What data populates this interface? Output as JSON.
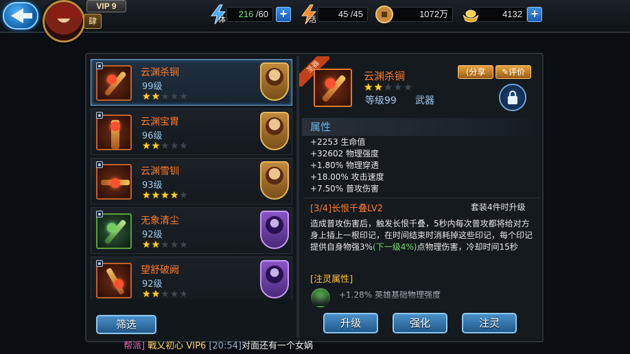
{
  "header": {
    "vip": "VIP 9",
    "rank": "肆",
    "stamina": {
      "label": "体",
      "value": "216",
      "max": "/60"
    },
    "energy": {
      "label": "活",
      "value": "45 /45"
    },
    "coins": "1072万",
    "gold": "4132",
    "plus": "+"
  },
  "equipment_list": [
    {
      "name": "云渊杀锏",
      "level": "99级",
      "stars": 2,
      "hero_color": "gold"
    },
    {
      "name": "云渊宝胄",
      "level": "96级",
      "stars": 2,
      "hero_color": "gold"
    },
    {
      "name": "云渊雪钏",
      "level": "93级",
      "stars": 4,
      "hero_color": "gold"
    },
    {
      "name": "无象清尘",
      "level": "92级",
      "stars": 2,
      "hero_color": "purple"
    },
    {
      "name": "望舒破阙",
      "level": "92级",
      "stars": 2,
      "hero_color": "purple"
    }
  ],
  "star_on": "★",
  "star_off": "★",
  "filter_label": "筛选",
  "detail": {
    "ribbon": "圣器",
    "name": "云渊杀锏",
    "stars": 2,
    "level": "等级99",
    "type": "武器",
    "share_label": "分享",
    "review_label": "评价",
    "attr_heading": "属性",
    "attributes": [
      "+2253 生命值",
      "+32602 物理强度",
      "+1.80% 物理穿透",
      "+18.00% 攻击速度",
      "+7.50% 普攻伤害"
    ],
    "set_title": "[3/4]长恨千叠LV2",
    "set_upgrade": "套装4件时升级",
    "desc_part1": "造成普攻伤害后，触发长恨千叠，5秒内每次普攻都将给对方身上插上一根印记，在时间结束时消耗掉这些印记，每个印记提供自身物强3%",
    "desc_highlight": "(下一级4%)",
    "desc_part2": "点物理伤害，冷却时间15秒",
    "spirit_title": "[注灵属性]",
    "spirit_item": "+1.28% 英雄基础物理强度"
  },
  "actions": {
    "upgrade": "升级",
    "enhance": "强化",
    "infuse": "注灵"
  },
  "chat": {
    "guild": "帮派]",
    "user": "戰乂初心 VIP6",
    "time": "[20:54]",
    "message": "对面还有一个女娲"
  }
}
